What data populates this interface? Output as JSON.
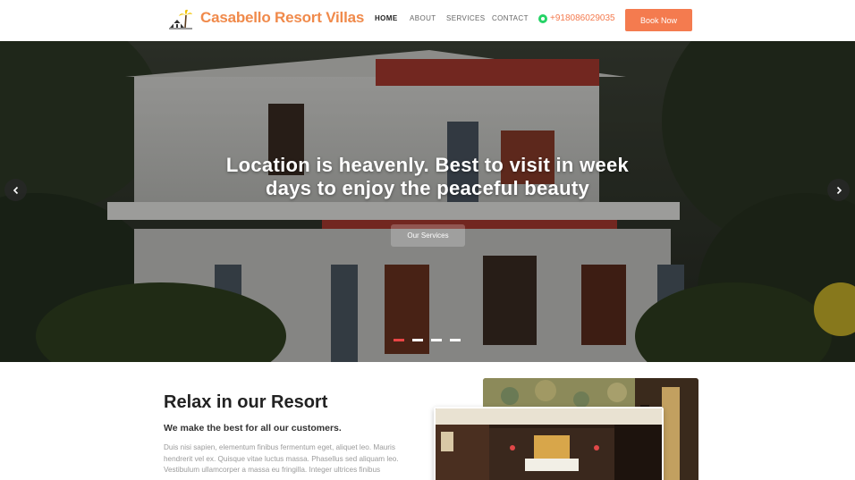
{
  "nav": {
    "brand": "Casabello Resort Villas",
    "items": [
      {
        "label": "HOME",
        "active": true
      },
      {
        "label": "ABOUT",
        "active": false
      },
      {
        "label": "SERVICES",
        "active": false
      },
      {
        "label": "CONTACT",
        "active": false
      }
    ],
    "phone": "+918086029035",
    "book_label": "Book Now"
  },
  "hero": {
    "title": "Location is heavenly. Best to visit in week days to enjoy the peaceful beauty",
    "button_label": "Our Services",
    "slides_count": 4,
    "active_slide": 0
  },
  "about": {
    "title": "Relax in our Resort",
    "subtitle": "We make the best for all our customers.",
    "body": "Duis nisi sapien, elementum finibus fermentum eget, aliquet leo. Mauris hendrerit vel ex. Quisque vitae luctus massa. Phasellus sed aliquam leo. Vestibulum ullamcorper a massa eu fringilla. Integer ultrices finibus"
  },
  "colors": {
    "accent": "#f47b4f",
    "brand": "#f08a4b",
    "dot_active": "#e84545",
    "whatsapp": "#25d366"
  },
  "icons": {
    "logo": "palm-house-logo",
    "phone": "whatsapp-icon",
    "prev": "chevron-left-icon",
    "next": "chevron-right-icon"
  }
}
